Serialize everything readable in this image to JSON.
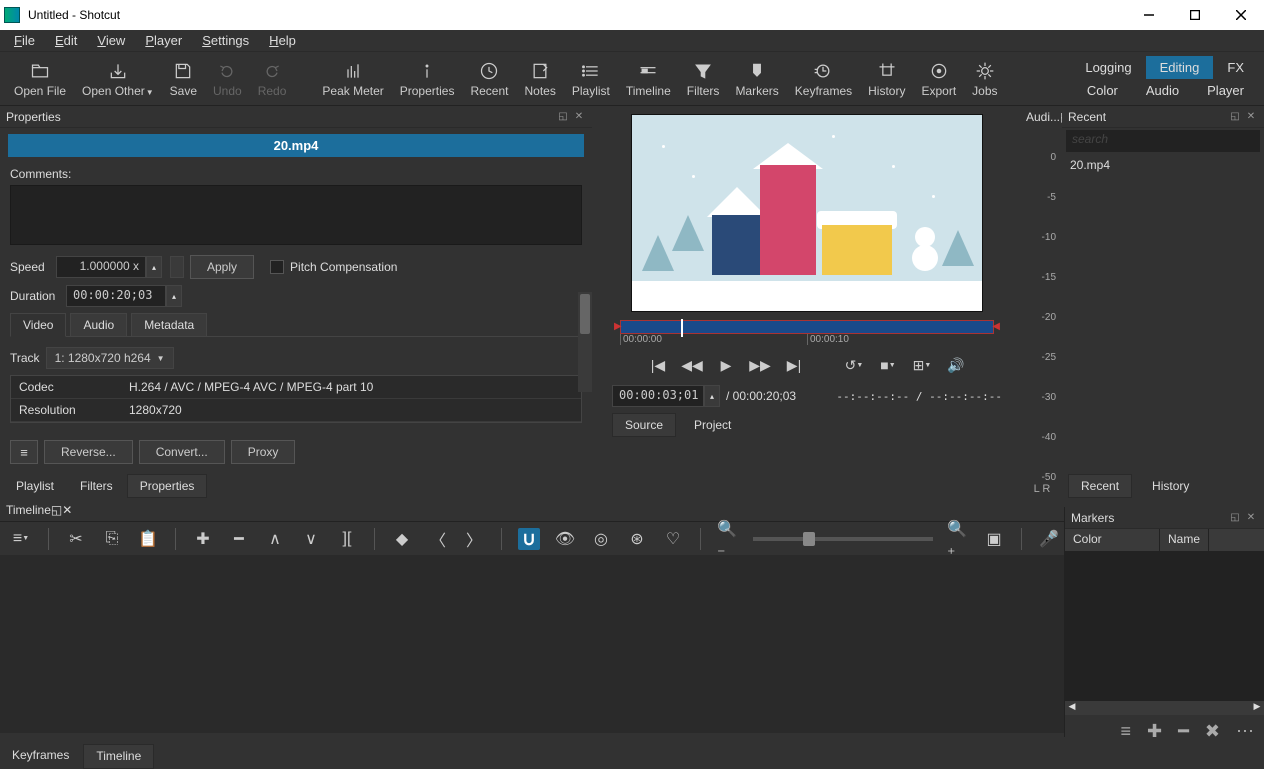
{
  "titlebar": {
    "title": "Untitled - Shotcut"
  },
  "menu": {
    "file": "File",
    "edit": "Edit",
    "view": "View",
    "player": "Player",
    "settings": "Settings",
    "help": "Help"
  },
  "toolbar": {
    "open_file": "Open File",
    "open_other": "Open Other",
    "save": "Save",
    "undo": "Undo",
    "redo": "Redo",
    "peak_meter": "Peak Meter",
    "properties": "Properties",
    "recent": "Recent",
    "notes": "Notes",
    "playlist": "Playlist",
    "timeline": "Timeline",
    "filters": "Filters",
    "markers": "Markers",
    "keyframes": "Keyframes",
    "history": "History",
    "export": "Export",
    "jobs": "Jobs"
  },
  "top_right": {
    "logging": "Logging",
    "editing": "Editing",
    "fx": "FX",
    "color": "Color",
    "audio": "Audio",
    "player": "Player"
  },
  "properties": {
    "title": "Properties",
    "filename": "20.mp4",
    "comments_label": "Comments:",
    "speed_label": "Speed",
    "speed_value": "1.000000 x",
    "apply": "Apply",
    "pitch_comp": "Pitch Compensation",
    "duration_label": "Duration",
    "duration_value": "00:00:20;03",
    "tabs": {
      "video": "Video",
      "audio": "Audio",
      "metadata": "Metadata"
    },
    "track_label": "Track",
    "track_value": "1: 1280x720 h264",
    "codec_k": "Codec",
    "codec_v": "H.264 / AVC / MPEG-4 AVC / MPEG-4 part 10",
    "res_k": "Resolution",
    "res_v": "1280x720",
    "reverse": "Reverse...",
    "convert": "Convert...",
    "proxy": "Proxy"
  },
  "dock_left": {
    "playlist": "Playlist",
    "filters": "Filters",
    "properties": "Properties"
  },
  "preview": {
    "scrub_0": "00:00:00",
    "scrub_10": "00:00:10",
    "tc_current": "00:00:03;01",
    "tc_total": "/ 00:00:20;03",
    "tc_inout": "--:--:--:-- / --:--:--:--",
    "source": "Source",
    "project": "Project"
  },
  "audio_panel": {
    "title": "Audi...",
    "lr": "L   R",
    "s0": "0",
    "s5": "-5",
    "s10": "-10",
    "s15": "-15",
    "s20": "-20",
    "s25": "-25",
    "s30": "-30",
    "s40": "-40",
    "s50": "-50"
  },
  "recent": {
    "title": "Recent",
    "search_ph": "search",
    "item0": "20.mp4",
    "tab_recent": "Recent",
    "tab_history": "History"
  },
  "timeline": {
    "title": "Timeline"
  },
  "markers": {
    "title": "Markers",
    "col_color": "Color",
    "col_name": "Name"
  },
  "bottom_dock": {
    "keyframes": "Keyframes",
    "timeline": "Timeline"
  }
}
